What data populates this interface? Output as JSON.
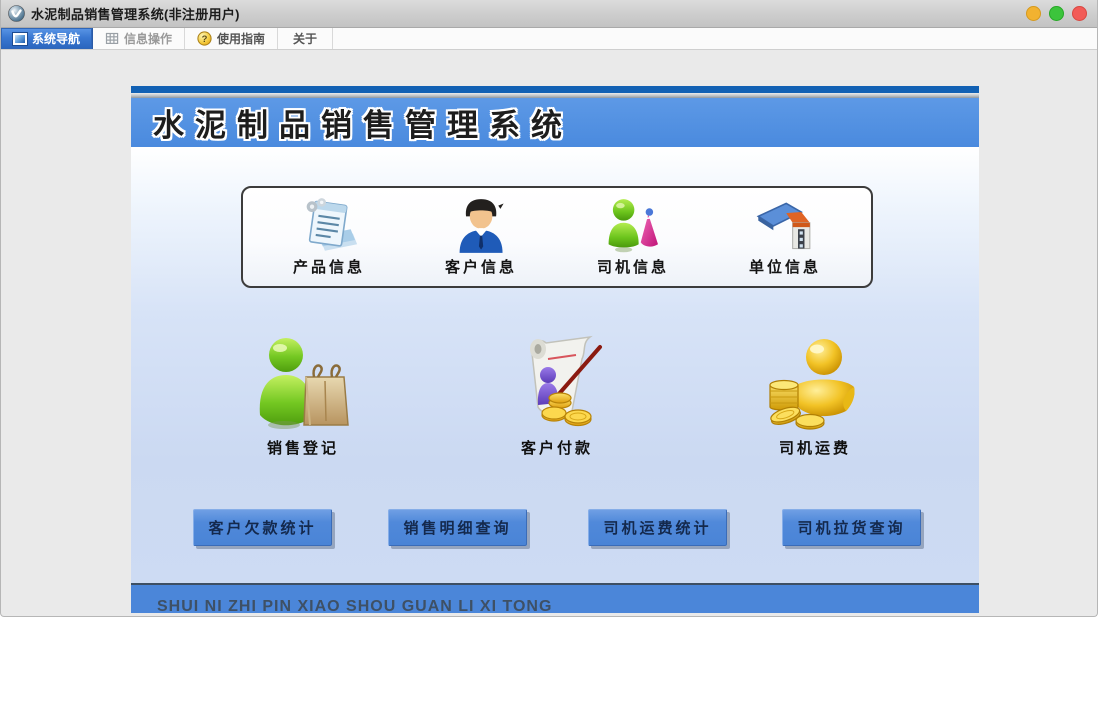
{
  "window": {
    "title": "水泥制品销售管理系统(非注册用户)",
    "controls": {
      "minimize": "minimize",
      "zoom": "zoom",
      "close": "close"
    }
  },
  "tabs": [
    {
      "label": "系统导航",
      "active": true,
      "icon": "monitor-icon"
    },
    {
      "label": "信息操作",
      "active": false,
      "icon": "grid-icon"
    },
    {
      "label": "使用指南",
      "active": false,
      "icon": "help-icon"
    },
    {
      "label": "关于",
      "active": false,
      "icon": ""
    }
  ],
  "banner": {
    "title": "水泥制品销售管理系统"
  },
  "info_box": {
    "items": [
      {
        "label": "产品信息",
        "icon": "product-notepad-icon"
      },
      {
        "label": "客户信息",
        "icon": "customer-person-icon"
      },
      {
        "label": "司机信息",
        "icon": "driver-person-cone-icon"
      },
      {
        "label": "单位信息",
        "icon": "unit-house-icon"
      }
    ]
  },
  "actions": {
    "items": [
      {
        "label": "销售登记",
        "icon": "green-person-bag-icon"
      },
      {
        "label": "客户付款",
        "icon": "scroll-pen-coins-icon"
      },
      {
        "label": "司机运费",
        "icon": "gold-person-coins-icon"
      }
    ]
  },
  "query_buttons": [
    {
      "label": "客户欠款统计"
    },
    {
      "label": "销售明细查询"
    },
    {
      "label": "司机运费统计"
    },
    {
      "label": "司机拉货查询"
    }
  ],
  "footer": {
    "text": "SHUI NI ZHI PIN XIAO SHOU GUAN LI XI TONG"
  },
  "help_icon_glyph": "?",
  "colors": {
    "stripe_dark_blue": "#1261b4",
    "banner_blue": "#4e8ee0",
    "footer_blue": "#4b86d9",
    "button_blue": "#5089da",
    "active_tab_blue": "#3a78d2",
    "traffic_yellow": "#f2b230",
    "traffic_green": "#3cc43c",
    "traffic_red": "#f25b57"
  }
}
